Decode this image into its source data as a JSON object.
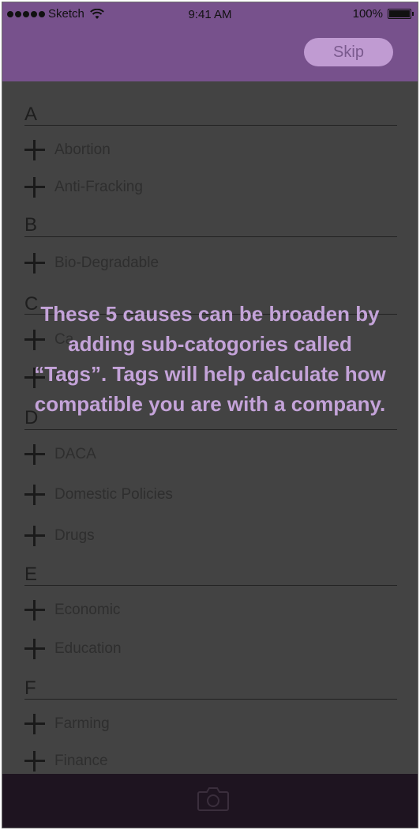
{
  "status_bar": {
    "carrier": "Sketch",
    "time": "9:41 AM",
    "battery": "100%",
    "signal_icon": "signal-dots-icon",
    "wifi_icon": "wifi-icon",
    "battery_icon": "battery-icon"
  },
  "header": {
    "skip_label": "Skip"
  },
  "overlay": {
    "message": "These 5 causes can be broaden by adding sub-catogories called “Tags”. Tags will help calculate how compatible you are with a company."
  },
  "sections": [
    {
      "letter": "A",
      "items": [
        "Abortion",
        "Anti-Fracking"
      ]
    },
    {
      "letter": "B",
      "items": [
        "Bio-Degradable"
      ]
    },
    {
      "letter": "C",
      "items": [
        "Ca",
        "Cl"
      ]
    },
    {
      "letter": "D",
      "items": [
        "DACA",
        "Domestic Policies",
        "Drugs"
      ]
    },
    {
      "letter": "E",
      "items": [
        "Economic",
        "Education"
      ]
    },
    {
      "letter": "F",
      "items": [
        "Farming",
        "Finance"
      ]
    }
  ],
  "bottom_bar": {
    "camera_icon": "camera-icon"
  },
  "colors": {
    "header": "#77518c",
    "skip_button": "#c09bd2",
    "overlay_text": "#c4a3d9",
    "dim_background": "#434343",
    "bottom_bar": "#1e1420"
  }
}
